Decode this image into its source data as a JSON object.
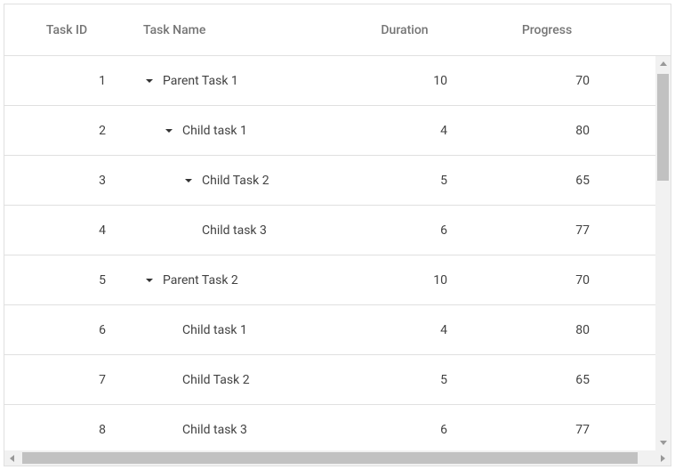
{
  "columns": {
    "id": {
      "label": "Task ID"
    },
    "name": {
      "label": "Task Name"
    },
    "dur": {
      "label": "Duration"
    },
    "prog": {
      "label": "Progress"
    }
  },
  "rows": [
    {
      "id": "1",
      "name": "Parent Task 1",
      "duration": "10",
      "progress": "70",
      "expander": true,
      "indent": 0
    },
    {
      "id": "2",
      "name": "Child task 1",
      "duration": "4",
      "progress": "80",
      "expander": true,
      "indent": 1
    },
    {
      "id": "3",
      "name": "Child Task 2",
      "duration": "5",
      "progress": "65",
      "expander": true,
      "indent": 2
    },
    {
      "id": "4",
      "name": "Child task 3",
      "duration": "6",
      "progress": "77",
      "expander": false,
      "indent": 2
    },
    {
      "id": "5",
      "name": "Parent Task 2",
      "duration": "10",
      "progress": "70",
      "expander": true,
      "indent": 0
    },
    {
      "id": "6",
      "name": "Child task 1",
      "duration": "4",
      "progress": "80",
      "expander": false,
      "indent": 1
    },
    {
      "id": "7",
      "name": "Child Task 2",
      "duration": "5",
      "progress": "65",
      "expander": false,
      "indent": 1
    },
    {
      "id": "8",
      "name": "Child task 3",
      "duration": "6",
      "progress": "77",
      "expander": false,
      "indent": 1
    }
  ]
}
